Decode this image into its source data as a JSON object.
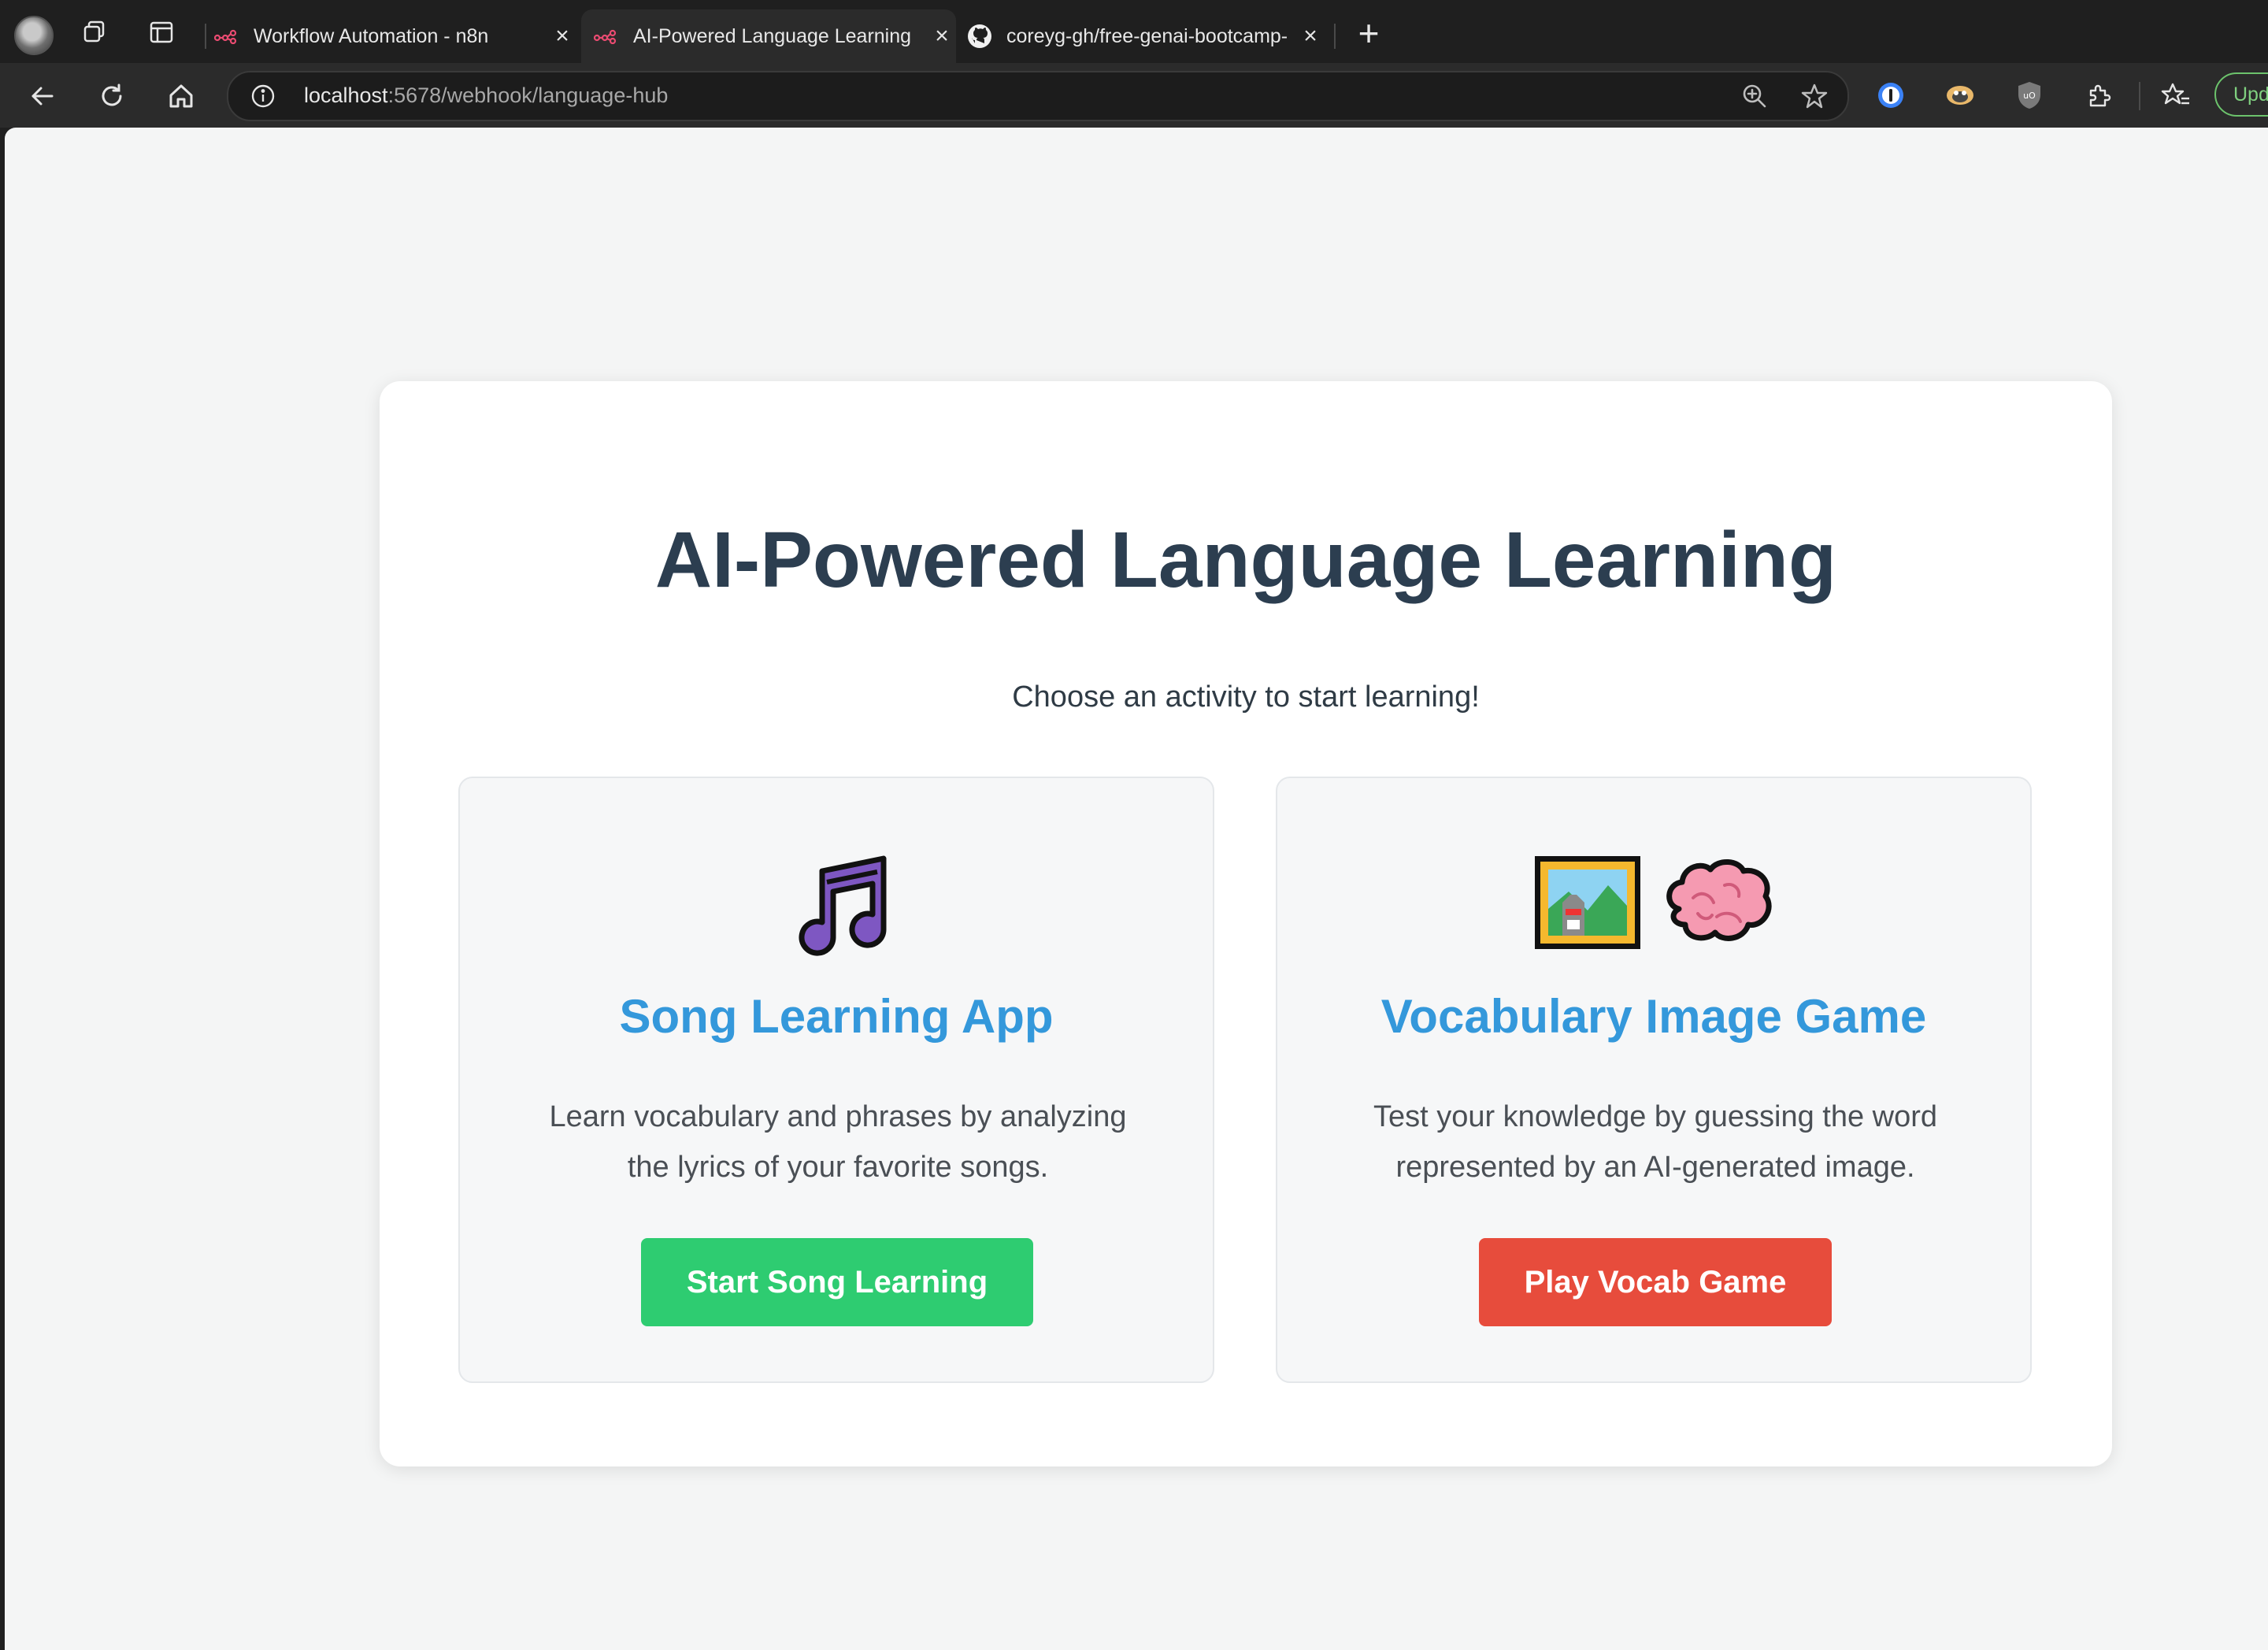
{
  "browser": {
    "tabs": [
      {
        "title": "Workflow Automation - n8n",
        "favicon": "n8n-icon",
        "active": false
      },
      {
        "title": "AI-Powered Language Learning",
        "favicon": "n8n-icon",
        "active": true
      },
      {
        "title": "coreyg-gh/free-genai-bootcamp-",
        "favicon": "github-icon",
        "active": false
      }
    ],
    "address": {
      "host": "localhost",
      "rest": ":5678/webhook/language-hub"
    },
    "update_label": "Upd"
  },
  "page": {
    "title": "AI-Powered Language Learning",
    "subtitle": "Choose an activity to start learning!",
    "activities": [
      {
        "icons": [
          "music-note-icon"
        ],
        "title": "Song Learning App",
        "description": "Learn vocabulary and phrases by analyzing the lyrics of your favorite songs.",
        "button_label": "Start Song Learning",
        "button_color": "#2ecc71"
      },
      {
        "icons": [
          "framed-picture-icon",
          "brain-icon"
        ],
        "title": "Vocabulary Image Game",
        "description": "Test your knowledge by guessing the word represented by an AI-generated image.",
        "button_label": "Play Vocab Game",
        "button_color": "#e74c3c"
      }
    ]
  },
  "colors": {
    "title": "#2c3e50",
    "heading_accent": "#3498db",
    "page_background": "#f4f5f5"
  }
}
